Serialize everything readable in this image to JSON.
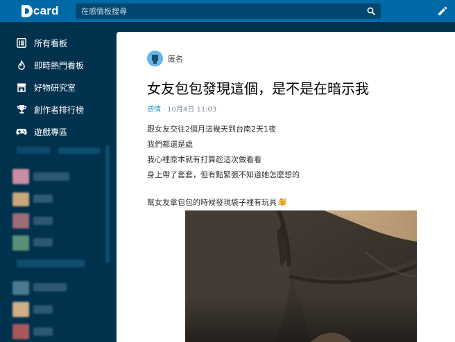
{
  "header": {
    "logo_text": "card",
    "search_placeholder": "在感情板搜尋"
  },
  "sidebar": {
    "items": [
      {
        "label": "所有看板",
        "icon": "list-icon"
      },
      {
        "label": "即時熱門看板",
        "icon": "flame-icon"
      },
      {
        "label": "好物研究室",
        "icon": "store-icon"
      },
      {
        "label": "創作者排行榜",
        "icon": "trophy-icon"
      },
      {
        "label": "遊戲專區",
        "icon": "gamepad-icon"
      }
    ]
  },
  "post": {
    "author": "匿名",
    "title": "女友包包發現這個，是不是在暗示我",
    "board": "感情",
    "separator": "·",
    "date": "10月4日 11:03",
    "lines": [
      "跟女友交往2個月這幾天到台南2天1夜",
      "我們都還是處",
      "我心裡原本就有打算趁這次做看看",
      "身上帶了套套，但有點緊張不知道她怎麼想的"
    ],
    "line_after_gap": "幫女友拿包包的時候發現袋子裡有玩具"
  },
  "colors": {
    "header": "#006aa6",
    "sidebar": "#00324e",
    "board_link": "#3397cf",
    "avatar": "#62b8e8"
  }
}
